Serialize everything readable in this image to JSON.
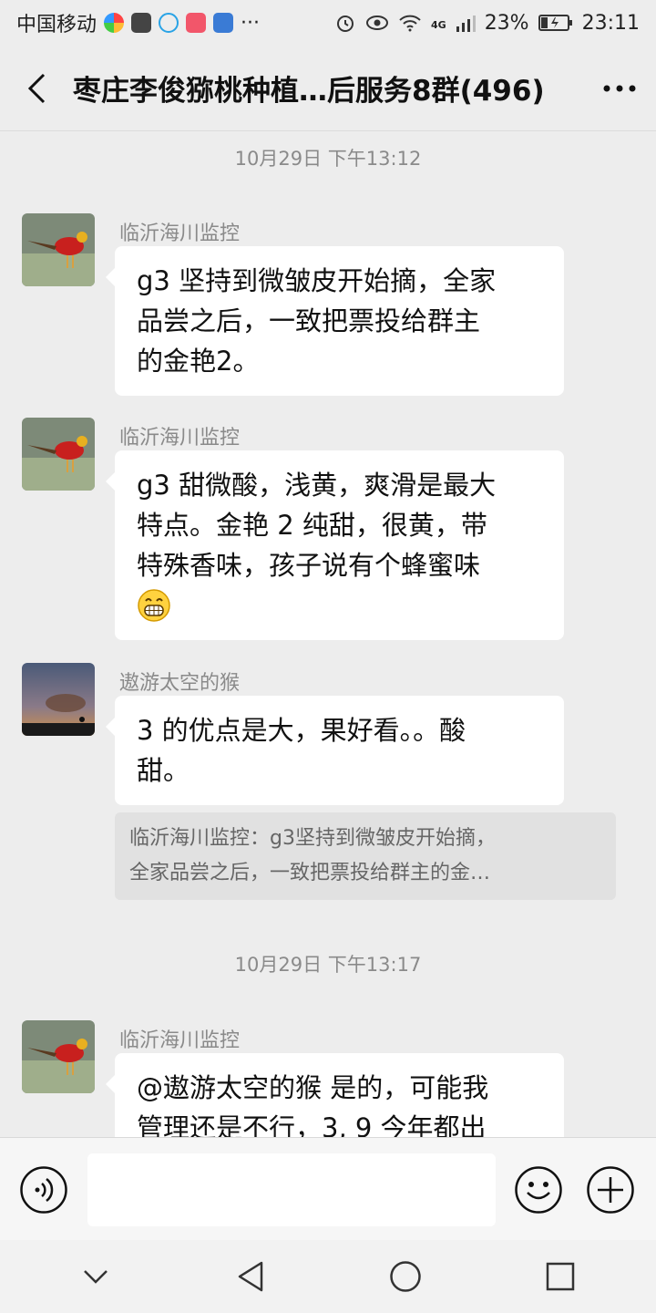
{
  "status_bar": {
    "carrier": "中国移动",
    "battery": "23%",
    "time": "23:11",
    "network": "4G",
    "dots": "···"
  },
  "header": {
    "title": "枣庄李俊猕桃种植…后服务8群(496)"
  },
  "messages": [
    {
      "time": "10月29日 下午13:12",
      "sender": "临沂海川监控",
      "lines": [
        "g3 坚持到微皱皮开始摘，全家",
        "品尝之后，一致把票投给群主",
        "的金艳2。"
      ]
    },
    {
      "sender": "临沂海川监控",
      "lines": [
        "g3 甜微酸，浅黄，爽滑是最大",
        "特点。金艳 2 纯甜，很黄，带",
        "特殊香味，孩子说有个蜂蜜味"
      ],
      "emoji": "grin-emoji"
    },
    {
      "sender": "遨游太空的猴",
      "lines": [
        "3 的优点是大，果好看。。酸",
        "甜。"
      ],
      "quote": [
        "临沂海川监控：g3坚持到微皱皮开始摘，",
        "全家品尝之后，一致把票投给群主的金…"
      ]
    },
    {
      "time": "10月29日 下午13:17",
      "sender": "临沂海川监控",
      "lines": [
        "@遨游太空的猴  是的，可能我",
        "管理还是不行，3, 9 今年都出"
      ]
    }
  ],
  "input_bar": {
    "placeholder": ""
  },
  "colors": {
    "background": "#ededed",
    "bubble": "#ffffff",
    "quote": "#e1e1e1",
    "meta_text": "#8a8a8a"
  }
}
